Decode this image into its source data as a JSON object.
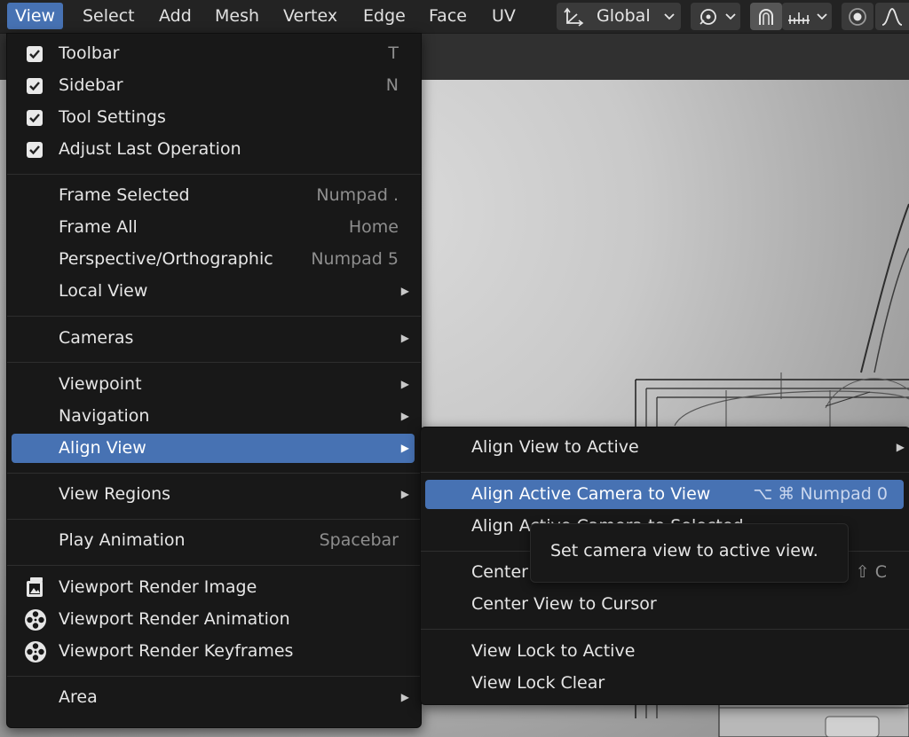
{
  "header": {
    "menus": [
      "View",
      "Select",
      "Add",
      "Mesh",
      "Vertex",
      "Edge",
      "Face",
      "UV"
    ],
    "active_menu": "View",
    "orientation_label": "Global"
  },
  "view_menu": {
    "items": [
      {
        "label": "Toolbar",
        "shortcut": "T",
        "checked": true
      },
      {
        "label": "Sidebar",
        "shortcut": "N",
        "checked": true
      },
      {
        "label": "Tool Settings",
        "shortcut": "",
        "checked": true
      },
      {
        "label": "Adjust Last Operation",
        "shortcut": "",
        "checked": true
      },
      {
        "label": "Frame Selected",
        "shortcut": "Numpad ."
      },
      {
        "label": "Frame All",
        "shortcut": "Home"
      },
      {
        "label": "Perspective/Orthographic",
        "shortcut": "Numpad 5"
      },
      {
        "label": "Local View",
        "submenu": true
      },
      {
        "label": "Cameras",
        "submenu": true
      },
      {
        "label": "Viewpoint",
        "submenu": true
      },
      {
        "label": "Navigation",
        "submenu": true
      },
      {
        "label": "Align View",
        "submenu": true,
        "highlighted": true
      },
      {
        "label": "View Regions",
        "submenu": true
      },
      {
        "label": "Play Animation",
        "shortcut": "Spacebar"
      },
      {
        "label": "Viewport Render Image",
        "icon": "render-image-icon"
      },
      {
        "label": "Viewport Render Animation",
        "icon": "render-animation-icon"
      },
      {
        "label": "Viewport Render Keyframes",
        "icon": "render-animation-icon"
      },
      {
        "label": "Area",
        "submenu": true
      }
    ]
  },
  "align_view_menu": {
    "items": [
      {
        "label": "Align View to Active",
        "submenu": true
      },
      {
        "label": "Align Active Camera to View",
        "shortcut": "⌥ ⌘ Numpad 0",
        "highlighted": true
      },
      {
        "label": "Align Active Camera to Selected",
        "shortcut": ""
      },
      {
        "label": "Center Cursor and Frame All",
        "shortcut": "⇧ C"
      },
      {
        "label": "Center View to Cursor",
        "shortcut": ""
      },
      {
        "label": "View Lock to Active",
        "shortcut": ""
      },
      {
        "label": "View Lock Clear",
        "shortcut": ""
      }
    ]
  },
  "tooltip": {
    "text": "Set camera view to active view."
  },
  "colors": {
    "accent": "#4772b3",
    "menu_bg": "#181818",
    "header_bg": "#232323"
  }
}
